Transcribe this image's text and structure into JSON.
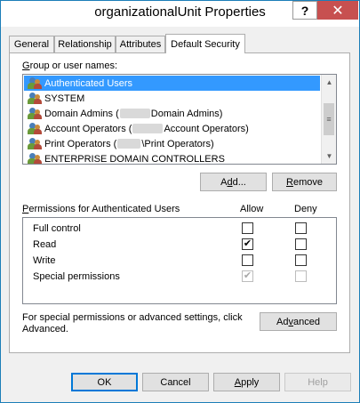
{
  "window": {
    "title": "organizationalUnit Properties",
    "help_glyph": "?",
    "close_glyph": "✕"
  },
  "tabs": [
    {
      "label": "General"
    },
    {
      "label": "Relationship"
    },
    {
      "label": "Attributes"
    },
    {
      "label": "Default Security"
    }
  ],
  "group_section": {
    "label_prefix": "",
    "label_access": "G",
    "label_rest": "roup or user names:",
    "items": [
      {
        "name_before": "Authenticated Users",
        "name_after": "",
        "selected": true
      },
      {
        "name_before": "SYSTEM",
        "name_after": "",
        "selected": false
      },
      {
        "name_before": "Domain Admins (",
        "name_after": "Domain Admins)",
        "selected": false
      },
      {
        "name_before": "Account Operators (",
        "name_after": "Account Operators)",
        "selected": false
      },
      {
        "name_before": "Print Operators (",
        "name_after": "\\Print Operators)",
        "selected": false
      },
      {
        "name_before": "ENTERPRISE DOMAIN CONTROLLERS",
        "name_after": "",
        "selected": false
      }
    ],
    "add_button": {
      "pre": "A",
      "u": "d",
      "post": "d..."
    },
    "remove_button": {
      "pre": "",
      "u": "R",
      "post": "emove"
    }
  },
  "permissions": {
    "header_label": {
      "u": "P",
      "rest": "ermissions for Authenticated Users"
    },
    "allow_header": "Allow",
    "deny_header": "Deny",
    "rows": [
      {
        "name": "Full control",
        "allow": "",
        "deny": "",
        "disabled": false
      },
      {
        "name": "Read",
        "allow": "✔",
        "deny": "",
        "disabled": false
      },
      {
        "name": "Write",
        "allow": "",
        "deny": "",
        "disabled": false
      },
      {
        "name": "Special permissions",
        "allow": "✔",
        "deny": "",
        "disabled": true
      }
    ]
  },
  "advanced": {
    "note_line1": "For special permissions or advanced settings, click",
    "note_line2": "Advanced.",
    "button": {
      "pre": "Ad",
      "u": "v",
      "post": "anced"
    }
  },
  "footer": {
    "ok": "OK",
    "cancel": "Cancel",
    "apply": {
      "u": "A",
      "post": "pply"
    },
    "help": "Help"
  }
}
